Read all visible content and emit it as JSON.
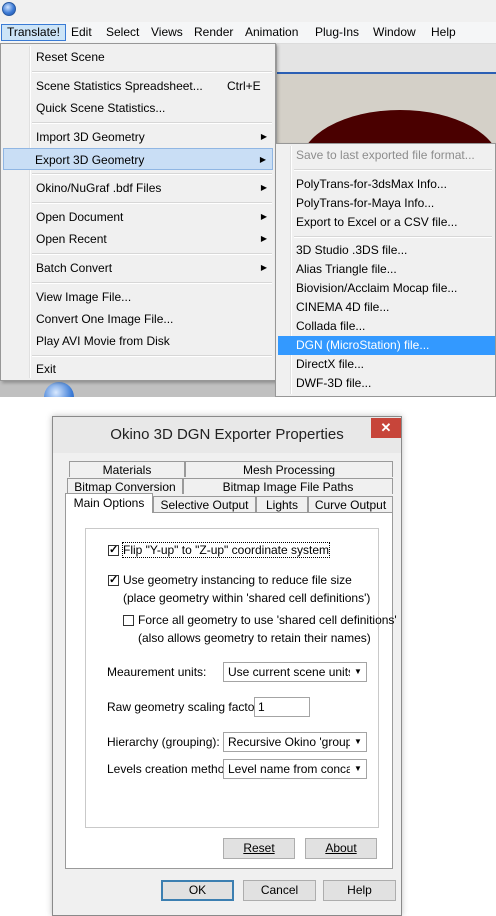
{
  "menubar": {
    "items": [
      "Translate!",
      "Edit",
      "Select",
      "Views",
      "Render",
      "Animation",
      "Plug-Ins",
      "Window",
      "Help"
    ]
  },
  "translate_menu": {
    "reset_scene": "Reset Scene",
    "scene_stats_spreadsheet": "Scene Statistics Spreadsheet...",
    "scene_stats_shortcut": "Ctrl+E",
    "quick_scene_stats": "Quick Scene Statistics...",
    "import_3d": "Import 3D Geometry",
    "export_3d": "Export 3D Geometry",
    "okino_bdf": "Okino/NuGraf .bdf Files",
    "open_document": "Open Document",
    "open_recent": "Open Recent",
    "batch_convert": "Batch Convert",
    "view_image": "View Image File...",
    "convert_image": "Convert One Image File...",
    "play_avi": "Play AVI Movie from Disk",
    "exit": "Exit"
  },
  "export_submenu": {
    "save_last": "Save to last exported file format...",
    "polytrans_3dsmax": "PolyTrans-for-3dsMax Info...",
    "polytrans_maya": "PolyTrans-for-Maya Info...",
    "export_excel": "Export to Excel or a CSV file...",
    "studio_3ds": "3D Studio .3DS file...",
    "alias_triangle": "Alias Triangle file...",
    "biovision": "Biovision/Acclaim Mocap file...",
    "cinema4d": "CINEMA 4D file...",
    "collada": "Collada file...",
    "dgn": "DGN (MicroStation) file...",
    "directx": "DirectX file...",
    "dwf3d": "DWF-3D file..."
  },
  "dialog": {
    "title": "Okino 3D DGN Exporter Properties",
    "close_glyph": "✕",
    "tabs": {
      "materials": "Materials",
      "mesh_processing": "Mesh Processing",
      "bitmap_conversion": "Bitmap Conversion",
      "bitmap_paths": "Bitmap Image File Paths",
      "main_options": "Main Options",
      "selective_output": "Selective Output",
      "lights": "Lights",
      "curve_output": "Curve Output"
    },
    "options": {
      "flip_yz": "Flip \"Y-up\" to \"Z-up\" coordinate system",
      "flip_yz_checked": true,
      "instancing": "Use geometry instancing to reduce file size",
      "instancing_note": "(place geometry within 'shared cell definitions')",
      "instancing_checked": true,
      "force_shared": "Force all geometry to use 'shared cell definitions'",
      "force_shared_note": "(also allows geometry to retain their names)",
      "force_shared_checked": false,
      "units_label": "Meaurement units:",
      "units_value": "Use current scene units (i",
      "scaling_label": "Raw geometry scaling factor:",
      "scaling_value": "1",
      "hierarchy_label": "Hierarchy (grouping):",
      "hierarchy_value": "Recursive Okino 'groupin",
      "levels_label": "Levels creation method:",
      "levels_value": "Level name from concate"
    },
    "buttons": {
      "reset": "Reset",
      "about": "About",
      "ok": "OK",
      "cancel": "Cancel",
      "help": "Help"
    }
  }
}
